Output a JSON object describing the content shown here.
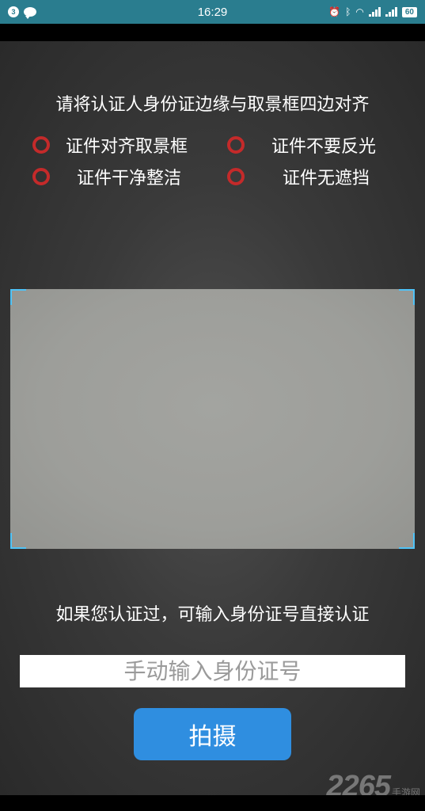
{
  "status_bar": {
    "notification_count": "3",
    "time": "16:29",
    "battery": "60"
  },
  "instruction": "请将认证人身份证边缘与取景框四边对齐",
  "tips": [
    "证件对齐取景框",
    "证件不要反光",
    "证件干净整洁",
    "证件无遮挡"
  ],
  "hint": "如果您认证过，可输入身份证号直接认证",
  "id_input": {
    "placeholder": "手动输入身份证号",
    "value": ""
  },
  "shoot_button_label": "拍摄",
  "watermark": {
    "number": "2265",
    "text": "手游网"
  },
  "colors": {
    "status_bar": "#2a7d8f",
    "tip_icon": "#c42a2a",
    "viewfinder_corner": "#4fc3f7",
    "button": "#2f8ee0"
  }
}
